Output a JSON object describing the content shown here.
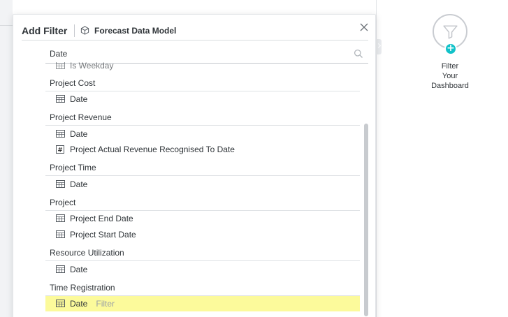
{
  "dialog": {
    "title": "Add Filter",
    "model_name": "Forecast Data Model",
    "search": {
      "value": "Date",
      "placeholder": ""
    }
  },
  "partial_item": {
    "label": "Is Weekday"
  },
  "groups": [
    {
      "name": "Project Cost",
      "items": [
        {
          "label": "Date",
          "type": "table"
        }
      ]
    },
    {
      "name": "Project Revenue",
      "items": [
        {
          "label": "Date",
          "type": "table"
        },
        {
          "label": "Project Actual Revenue Recognised To Date",
          "type": "number"
        }
      ]
    },
    {
      "name": "Project Time",
      "items": [
        {
          "label": "Date",
          "type": "table"
        }
      ]
    },
    {
      "name": "Project",
      "items": [
        {
          "label": "Project End Date",
          "type": "table"
        },
        {
          "label": "Project Start Date",
          "type": "table"
        }
      ]
    },
    {
      "name": "Resource Utilization",
      "items": [
        {
          "label": "Date",
          "type": "table"
        }
      ]
    },
    {
      "name": "Time Registration",
      "items": [
        {
          "label": "Date",
          "type": "table",
          "hint": "Filter",
          "highlighted": true
        }
      ]
    }
  ],
  "side_panel": {
    "label": "Filter\nYour\nDashboard"
  },
  "colors": {
    "highlight": "#fcfa9b",
    "accent": "#11c2c9",
    "text": "#2f3438",
    "muted": "#9aa0a6"
  }
}
